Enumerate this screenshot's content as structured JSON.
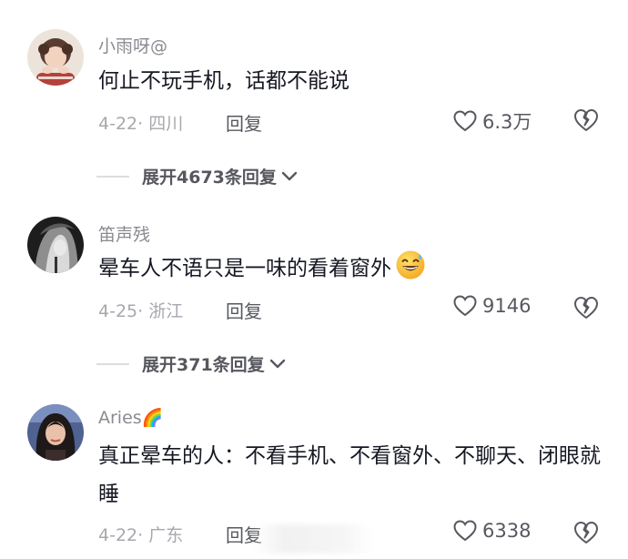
{
  "comments": [
    {
      "username": "小雨呀@",
      "text": "何止不玩手机，话都不能说",
      "meta": "4-22· 四川",
      "reply_label": "回复",
      "likes": "6.3万",
      "expand_label": "展开4673条回复",
      "avatar_colors": [
        "#e9ddd2",
        "#3a2a25"
      ]
    },
    {
      "username": "笛声残",
      "text": "晕车人不语只是一味的看着窗外",
      "emoji": "grinning-sweat-emoji",
      "meta": "4-25· 浙江",
      "reply_label": "回复",
      "likes": "9146",
      "expand_label": "展开371条回复",
      "avatar_colors": [
        "#1e1e1e",
        "#cfcfcf"
      ]
    },
    {
      "username": "Aries🌈",
      "text": "真正晕车的人：不看手机、不看窗外、不聊天、闭眼就睡",
      "meta": "4-22· 广东",
      "reply_label": "回复",
      "likes": "6338",
      "avatar_colors": [
        "#5b6e9b",
        "#2a1f1f"
      ]
    }
  ],
  "icons": {
    "like": "heart-outline-icon",
    "dislike": "broken-heart-icon",
    "expand": "chevron-down-icon"
  }
}
